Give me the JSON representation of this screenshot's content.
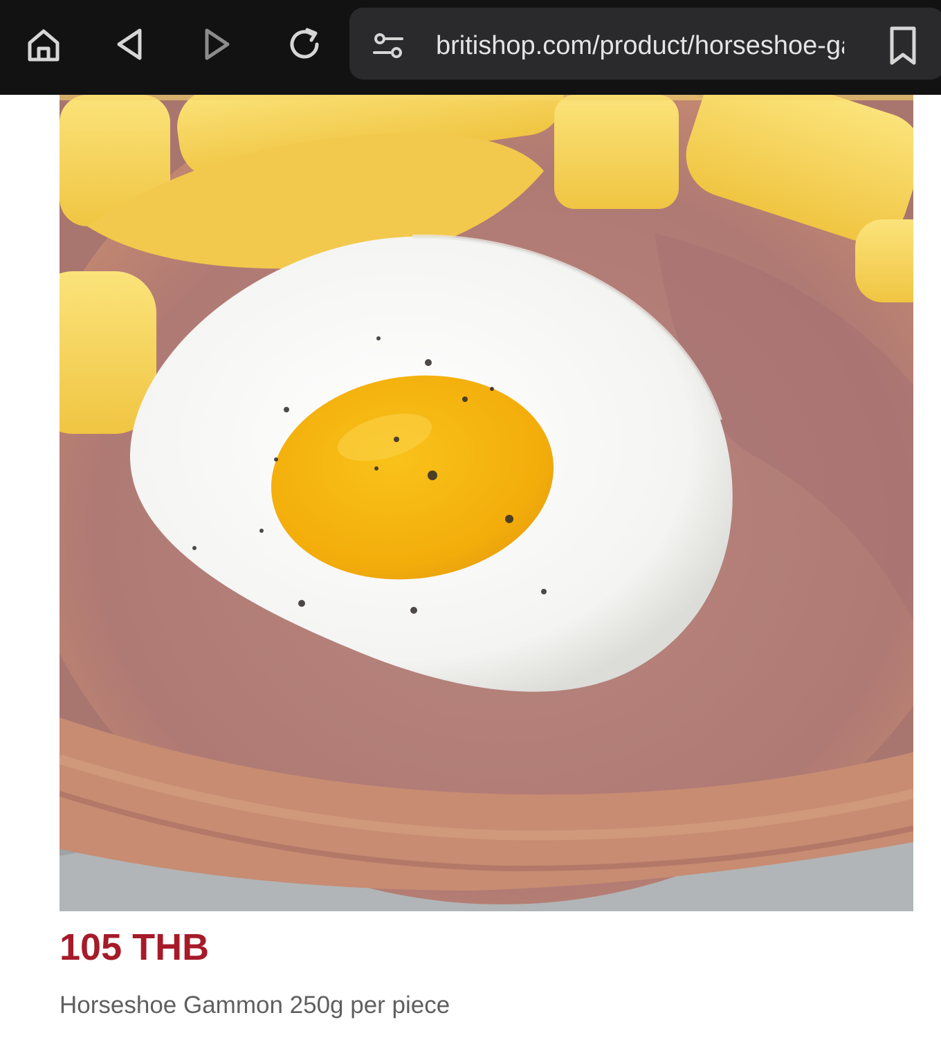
{
  "browser": {
    "url": "britishop.com/product/horseshoe-gammon",
    "icons": {
      "home": "home-icon",
      "back": "back-arrow-icon",
      "forward": "forward-arrow-icon",
      "reload": "reload-icon",
      "site_settings": "site-settings-icon",
      "bookmark": "bookmark-icon"
    }
  },
  "product": {
    "price": "105 THB",
    "name": "Horseshoe Gammon 250g per piece",
    "image": "product-photo-gammon-with-fried-egg-and-chips"
  },
  "colors": {
    "toolbar_background": "#121212",
    "urlbar_background": "#2a2a2c",
    "price": "#a61b29",
    "product_name": "#5f5f5f"
  }
}
